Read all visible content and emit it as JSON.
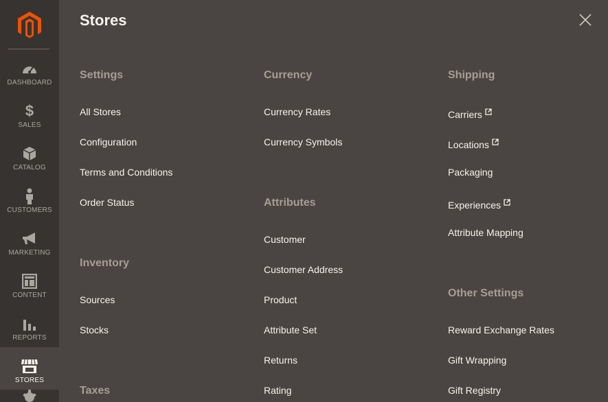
{
  "sidebar": {
    "items": [
      {
        "label": "DASHBOARD",
        "icon": "dashboard-icon"
      },
      {
        "label": "SALES",
        "icon": "dollar-icon"
      },
      {
        "label": "CATALOG",
        "icon": "box-icon"
      },
      {
        "label": "CUSTOMERS",
        "icon": "person-icon"
      },
      {
        "label": "MARKETING",
        "icon": "megaphone-icon"
      },
      {
        "label": "CONTENT",
        "icon": "layout-icon"
      },
      {
        "label": "REPORTS",
        "icon": "bar-chart-icon"
      },
      {
        "label": "STORES",
        "icon": "storefront-icon"
      }
    ],
    "active": "STORES",
    "colors": {
      "background": "#373330",
      "active": "#4a4542",
      "logo": "#eb5202"
    }
  },
  "panel": {
    "title": "Stores",
    "close_icon": "close-icon",
    "columns": [
      {
        "sections": [
          {
            "title": "Settings",
            "links": [
              "All Stores",
              "Configuration",
              "Terms and Conditions",
              "Order Status"
            ]
          },
          {
            "title": "Inventory",
            "links": [
              "Sources",
              "Stocks"
            ]
          },
          {
            "title": "Taxes",
            "links": []
          }
        ]
      },
      {
        "sections": [
          {
            "title": "Currency",
            "links": [
              "Currency Rates",
              "Currency Symbols"
            ]
          },
          {
            "title": "Attributes",
            "links": [
              "Customer",
              "Customer Address",
              "Product",
              "Attribute Set",
              "Returns",
              "Rating"
            ]
          }
        ]
      },
      {
        "sections": [
          {
            "title": "Shipping",
            "links": [
              "Carriers",
              "Locations",
              "Packaging",
              "Experiences",
              "Attribute Mapping"
            ]
          },
          {
            "title": "Other Settings",
            "links": [
              "Reward Exchange Rates",
              "Gift Wrapping",
              "Gift Registry"
            ]
          }
        ]
      }
    ],
    "external_link_icon": "external-link-icon"
  }
}
